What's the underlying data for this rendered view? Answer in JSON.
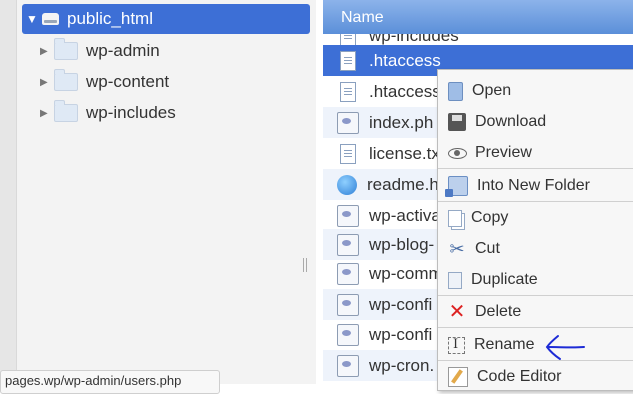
{
  "tree": {
    "root_label": "public_html",
    "items": [
      {
        "label": "wp-admin"
      },
      {
        "label": "wp-content"
      },
      {
        "label": "wp-includes"
      }
    ]
  },
  "status_bar": {
    "text": "pages.wp/wp-admin/users.php"
  },
  "file_list": {
    "header": "Name",
    "partial_top_row": "wp-includes",
    "rows": [
      {
        "name": ".htaccess",
        "icon": "document-icon"
      },
      {
        "name": ".htaccess",
        "icon": "document-icon"
      },
      {
        "name": "index.ph",
        "icon": "php-file-icon"
      },
      {
        "name": "license.tx",
        "icon": "document-icon"
      },
      {
        "name": "readme.h",
        "icon": "html-file-icon"
      },
      {
        "name": "wp-activa",
        "icon": "php-file-icon"
      },
      {
        "name": "wp-blog-",
        "icon": "php-file-icon"
      },
      {
        "name": "wp-comm",
        "icon": "php-file-icon"
      },
      {
        "name": "wp-confi",
        "icon": "php-file-icon"
      },
      {
        "name": "wp-confi",
        "icon": "php-file-icon"
      },
      {
        "name": "wp-cron.",
        "icon": "php-file-icon"
      }
    ]
  },
  "context_menu": {
    "items": [
      {
        "label": "Open",
        "icon": "open-icon"
      },
      {
        "label": "Download",
        "icon": "download-icon"
      },
      {
        "label": "Preview",
        "icon": "eye-icon"
      },
      {
        "label": "Into New Folder",
        "icon": "new-folder-icon"
      },
      {
        "label": "Copy",
        "icon": "copy-icon"
      },
      {
        "label": "Cut",
        "icon": "scissors-icon"
      },
      {
        "label": "Duplicate",
        "icon": "duplicate-icon"
      },
      {
        "label": "Delete",
        "icon": "delete-icon"
      },
      {
        "label": "Rename",
        "icon": "rename-icon"
      },
      {
        "label": "Code Editor",
        "icon": "code-editor-icon"
      }
    ]
  },
  "colors": {
    "selection": "#3d6fd6",
    "annotation": "#1d2bd6",
    "delete": "#dd2222"
  }
}
